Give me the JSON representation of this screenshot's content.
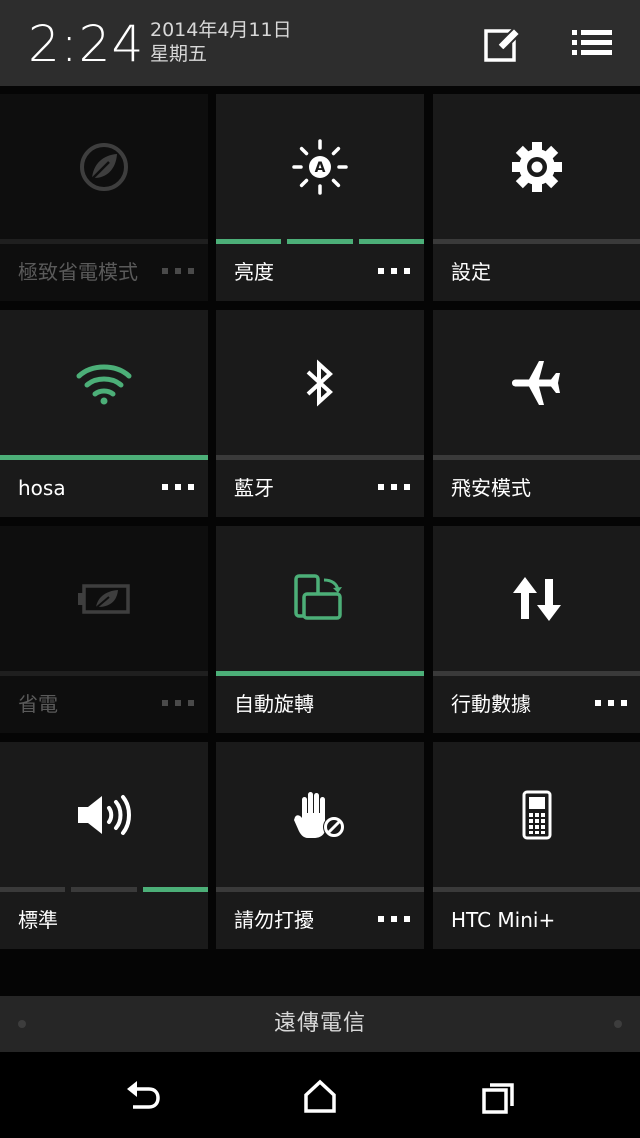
{
  "status": {
    "time": "2:24",
    "date": "2014年4月11日",
    "weekday": "星期五"
  },
  "tiles": [
    {
      "label": "極致省電模式",
      "icon": "leaf-circle-icon",
      "dim": true,
      "more": true
    },
    {
      "label": "亮度",
      "icon": "brightness-auto-icon",
      "dim": false,
      "more": true
    },
    {
      "label": "設定",
      "icon": "gear-icon",
      "dim": false,
      "more": false
    },
    {
      "label": "hosa",
      "icon": "wifi-icon",
      "dim": false,
      "more": true
    },
    {
      "label": "藍牙",
      "icon": "bluetooth-icon",
      "dim": false,
      "more": true
    },
    {
      "label": "飛安模式",
      "icon": "airplane-icon",
      "dim": false,
      "more": false
    },
    {
      "label": "省電",
      "icon": "battery-leaf-icon",
      "dim": true,
      "more": true
    },
    {
      "label": "自動旋轉",
      "icon": "auto-rotate-icon",
      "dim": false,
      "more": false
    },
    {
      "label": "行動數據",
      "icon": "data-arrows-icon",
      "dim": false,
      "more": true
    },
    {
      "label": "標準",
      "icon": "speaker-icon",
      "dim": false,
      "more": false
    },
    {
      "label": "請勿打擾",
      "icon": "do-not-disturb-hand-icon",
      "dim": false,
      "more": true
    },
    {
      "label": "HTC Mini+",
      "icon": "phone-remote-icon",
      "dim": false,
      "more": false
    }
  ],
  "indicators": {
    "brightness_level": "3 of 3",
    "wifi_on": true,
    "auto_rotate_on": true,
    "sound_profile_level": "3 of 3"
  },
  "carrier": "遠傳電信",
  "colors": {
    "accent_green": "#4caf78",
    "tile_bg": "#1a1a1a",
    "header_bg": "#2d2d2d"
  }
}
